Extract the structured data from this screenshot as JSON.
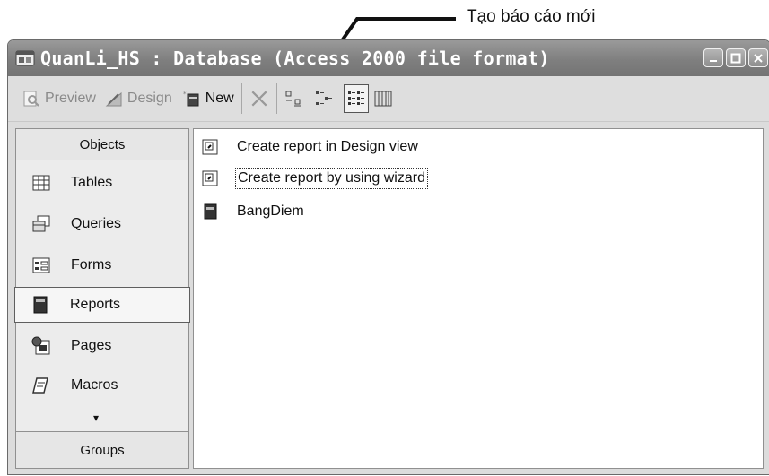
{
  "callout": {
    "text": "Tạo báo cáo mới"
  },
  "window": {
    "title": "QuanLi_HS : Database (Access 2000 file format)",
    "buttons": [
      "minimize-icon",
      "maximize-icon",
      "close-icon"
    ]
  },
  "toolbar": {
    "preview_label": "Preview",
    "design_label": "Design",
    "new_label": "New",
    "icons": [
      "preview-icon",
      "design-icon",
      "new-icon",
      "delete-icon",
      "large-icons-view-icon",
      "small-icons-view-icon",
      "list-view-icon",
      "details-view-icon"
    ]
  },
  "sidebar": {
    "header": "Objects",
    "items": [
      {
        "label": "Tables",
        "icon": "table-icon"
      },
      {
        "label": "Queries",
        "icon": "query-icon"
      },
      {
        "label": "Forms",
        "icon": "form-icon"
      },
      {
        "label": "Reports",
        "icon": "report-icon",
        "selected": true
      },
      {
        "label": "Pages",
        "icon": "page-icon"
      },
      {
        "label": "Macros",
        "icon": "macro-icon"
      }
    ],
    "more": "▾",
    "footer": "Groups"
  },
  "list": {
    "items": [
      {
        "label": "Create report in Design view",
        "icon": "design-shortcut-icon"
      },
      {
        "label": "Create report by using wizard",
        "icon": "wizard-shortcut-icon",
        "focused": true
      },
      {
        "label": "BangDiem",
        "icon": "report-icon"
      }
    ]
  },
  "colors": {
    "titlebar": "#888888",
    "window_bg": "#dcdcdc",
    "list_bg": "#ffffff"
  }
}
